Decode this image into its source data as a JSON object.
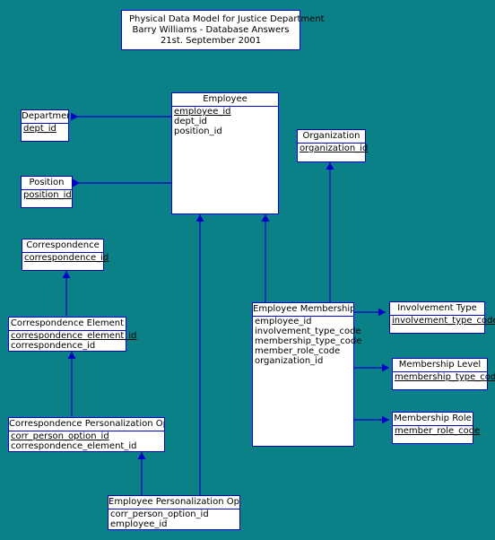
{
  "diagram": {
    "title_block": {
      "lines": [
        "Physical Data Model for Justice Department",
        "Barry Williams - Database Answers",
        "21st. September 2001"
      ]
    },
    "colors": {
      "background": "#0a8186",
      "box_fill": "#ffffff",
      "box_border": "#0000cc",
      "connector": "#0000cc",
      "text": "#000000"
    },
    "entities": [
      {
        "id": "employee",
        "name": "Employee",
        "attributes": [
          {
            "name": "employee_id",
            "key": true
          },
          {
            "name": "dept_id",
            "key": false
          },
          {
            "name": "position_id",
            "key": false
          }
        ]
      },
      {
        "id": "department",
        "name": "Department",
        "attributes": [
          {
            "name": "dept_id",
            "key": true
          }
        ]
      },
      {
        "id": "position",
        "name": "Position",
        "attributes": [
          {
            "name": "position_id",
            "key": true
          }
        ]
      },
      {
        "id": "organization",
        "name": "Organization",
        "attributes": [
          {
            "name": "organization_id",
            "key": true
          }
        ]
      },
      {
        "id": "correspondence",
        "name": "Correspondence",
        "attributes": [
          {
            "name": "correspondence_id",
            "key": true
          }
        ]
      },
      {
        "id": "correspondence_element",
        "name": "Correspondence Element",
        "attributes": [
          {
            "name": "correspondence_element_id",
            "key": true
          },
          {
            "name": "correspondence_id",
            "key": false
          }
        ]
      },
      {
        "id": "correspondence_personalization_option",
        "name": "Correspondence Personalization Option",
        "attributes": [
          {
            "name": "corr_person_option_id",
            "key": true
          },
          {
            "name": "correspondence_element_id",
            "key": false
          }
        ]
      },
      {
        "id": "employee_personalization_option",
        "name": "Employee Personalization Option",
        "attributes": [
          {
            "name": "corr_person_option_id",
            "key": false
          },
          {
            "name": "employee_id",
            "key": false
          }
        ]
      },
      {
        "id": "employee_membership",
        "name": "Employee Membership",
        "attributes": [
          {
            "name": "employee_id",
            "key": false
          },
          {
            "name": "involvement_type_code",
            "key": false
          },
          {
            "name": "membership_type_code",
            "key": false
          },
          {
            "name": "member_role_code",
            "key": false
          },
          {
            "name": "organization_id",
            "key": false
          }
        ]
      },
      {
        "id": "involvement_type",
        "name": "Involvement Type",
        "attributes": [
          {
            "name": "involvement_type_code",
            "key": true
          }
        ]
      },
      {
        "id": "membership_level",
        "name": "Membership Level",
        "attributes": [
          {
            "name": "membership_type_code",
            "key": true
          }
        ]
      },
      {
        "id": "membership_role",
        "name": "Membership Role",
        "attributes": [
          {
            "name": "member_role_code",
            "key": true
          }
        ]
      }
    ],
    "relationships": [
      {
        "from": "employee",
        "to": "department"
      },
      {
        "from": "employee",
        "to": "position"
      },
      {
        "from": "employee_membership",
        "to": "employee"
      },
      {
        "from": "employee_membership",
        "to": "organization"
      },
      {
        "from": "employee_membership",
        "to": "involvement_type"
      },
      {
        "from": "employee_membership",
        "to": "membership_level"
      },
      {
        "from": "employee_membership",
        "to": "membership_role"
      },
      {
        "from": "correspondence_element",
        "to": "correspondence"
      },
      {
        "from": "correspondence_personalization_option",
        "to": "correspondence_element"
      },
      {
        "from": "employee_personalization_option",
        "to": "employee"
      },
      {
        "from": "employee_personalization_option",
        "to": "correspondence_personalization_option"
      }
    ]
  }
}
